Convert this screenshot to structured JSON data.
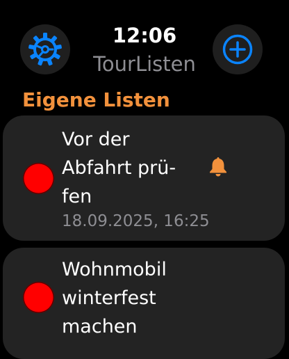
{
  "header": {
    "time": "12:06",
    "app_title": "TourListen",
    "settings_icon": "gear-icon",
    "add_icon": "plus-circle-icon",
    "accent_color": "#0a84ff"
  },
  "section": {
    "title": "Eigene Listen",
    "color": "#f2913c"
  },
  "lists": [
    {
      "title_lines": [
        "Vor der",
        "Abfahrt prü-",
        "fen"
      ],
      "date": "18.09.2025, 16:25",
      "has_reminder": true,
      "reminder_icon": "bell-icon",
      "status_color": "#ff0000"
    },
    {
      "title_lines": [
        "Wohnmobil",
        "winterfest",
        "machen"
      ],
      "status_color": "#ff0000"
    }
  ]
}
